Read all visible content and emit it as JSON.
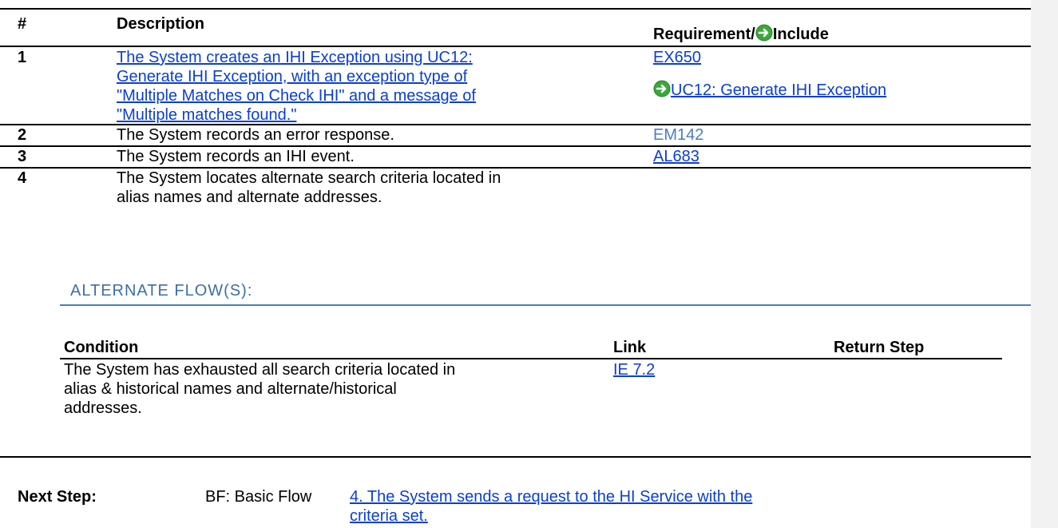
{
  "main_table": {
    "headers": {
      "num": "#",
      "description": "Description",
      "requirement_prefix": "Requirement/",
      "requirement_suffix": "Include"
    },
    "rows": [
      {
        "num": "1",
        "description_lines": [
          "The System creates an IHI Exception using UC12:",
          "Generate IHI Exception, with an exception type of",
          "\"Multiple Matches on Check IHI\" and a message of",
          "\"Multiple matches found.\""
        ],
        "req_link": "EX650",
        "include_link": "UC12: Generate IHI Exception"
      },
      {
        "num": "2",
        "description": "The System records an error response.",
        "req_text": "EM142"
      },
      {
        "num": "3",
        "description": "The System records an IHI event.",
        "req_link": "AL683"
      },
      {
        "num": "4",
        "description_lines": [
          "The System locates alternate search criteria located in",
          "alias names and alternate addresses."
        ]
      }
    ]
  },
  "alternate_flows": {
    "heading": "ALTERNATE FLOW(S):",
    "headers": {
      "condition": "Condition",
      "link": "Link",
      "return_step": "Return Step"
    },
    "rows": [
      {
        "condition_lines": [
          "The System has exhausted all search criteria located in",
          "alias & historical names and alternate/historical",
          "addresses."
        ],
        "link": "IE 7.2",
        "return_step": ""
      }
    ]
  },
  "next_step": {
    "label": "Next Step:",
    "flow": "BF: Basic Flow",
    "link_lines": [
      "4. The System sends a request to the HI Service with the",
      "criteria set."
    ]
  },
  "icons": {
    "include": "green-circle-arrow-icon"
  },
  "colors": {
    "link": "#0b3fd0",
    "plain_ref": "#4a7fc1",
    "heading": "#3d6fa6",
    "icon_green": "#3aa83a"
  }
}
